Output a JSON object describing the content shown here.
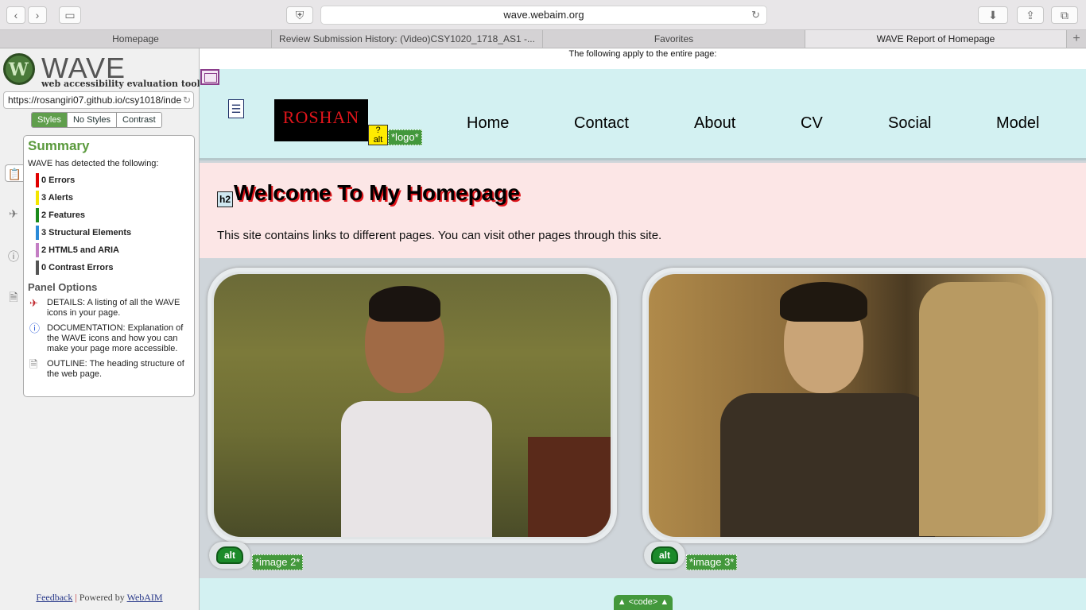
{
  "browser": {
    "url": "wave.webaim.org",
    "tabs": [
      "Homepage",
      "Review Submission History: (Video)CSY1020_1718_AS1 -...",
      "Favorites",
      "WAVE Report of Homepage"
    ]
  },
  "sidebar": {
    "logo_word": "WAVE",
    "logo_subtitle": "web accessibility evaluation tool",
    "url_field": "https://rosangiri07.github.io/csy1018/inde",
    "style_tabs": [
      "Styles",
      "No Styles",
      "Contrast"
    ],
    "summary_title": "Summary",
    "summary_intro": "WAVE has detected the following:",
    "stats": [
      {
        "label": "0 Errors",
        "color": "#e00000"
      },
      {
        "label": "3 Alerts",
        "color": "#f4e600"
      },
      {
        "label": "2 Features",
        "color": "#1a8a1a"
      },
      {
        "label": "3 Structural Elements",
        "color": "#2a8ad8"
      },
      {
        "label": "2 HTML5 and ARIA",
        "color": "#c47ec4"
      },
      {
        "label": "0 Contrast Errors",
        "color": "#555555"
      }
    ],
    "panel_options_title": "Panel Options",
    "options": [
      "DETAILS: A listing of all the WAVE icons in your page.",
      "DOCUMENTATION: Explanation of the WAVE icons and how you can make your page more accessible.",
      "OUTLINE: The heading structure of the web page."
    ],
    "footer_feedback": "Feedback",
    "footer_powered": "Powered by",
    "footer_webaim": "WebAIM"
  },
  "page": {
    "notice": "The following apply to the entire page:",
    "logo_text": "ROSHAN",
    "alt_logo": "*logo*",
    "alt_icon_text": "alt",
    "nav": [
      "Home",
      "Contact",
      "About",
      "CV",
      "Social",
      "Model"
    ],
    "h2_icon": "h2",
    "title": "Welcome To My Homepage",
    "intro": "This site contains links to different pages. You can visit other pages through this site.",
    "image2_label": "*image 2*",
    "image3_label": "*image 3*",
    "code_tab": "▲ <code> ▲"
  }
}
